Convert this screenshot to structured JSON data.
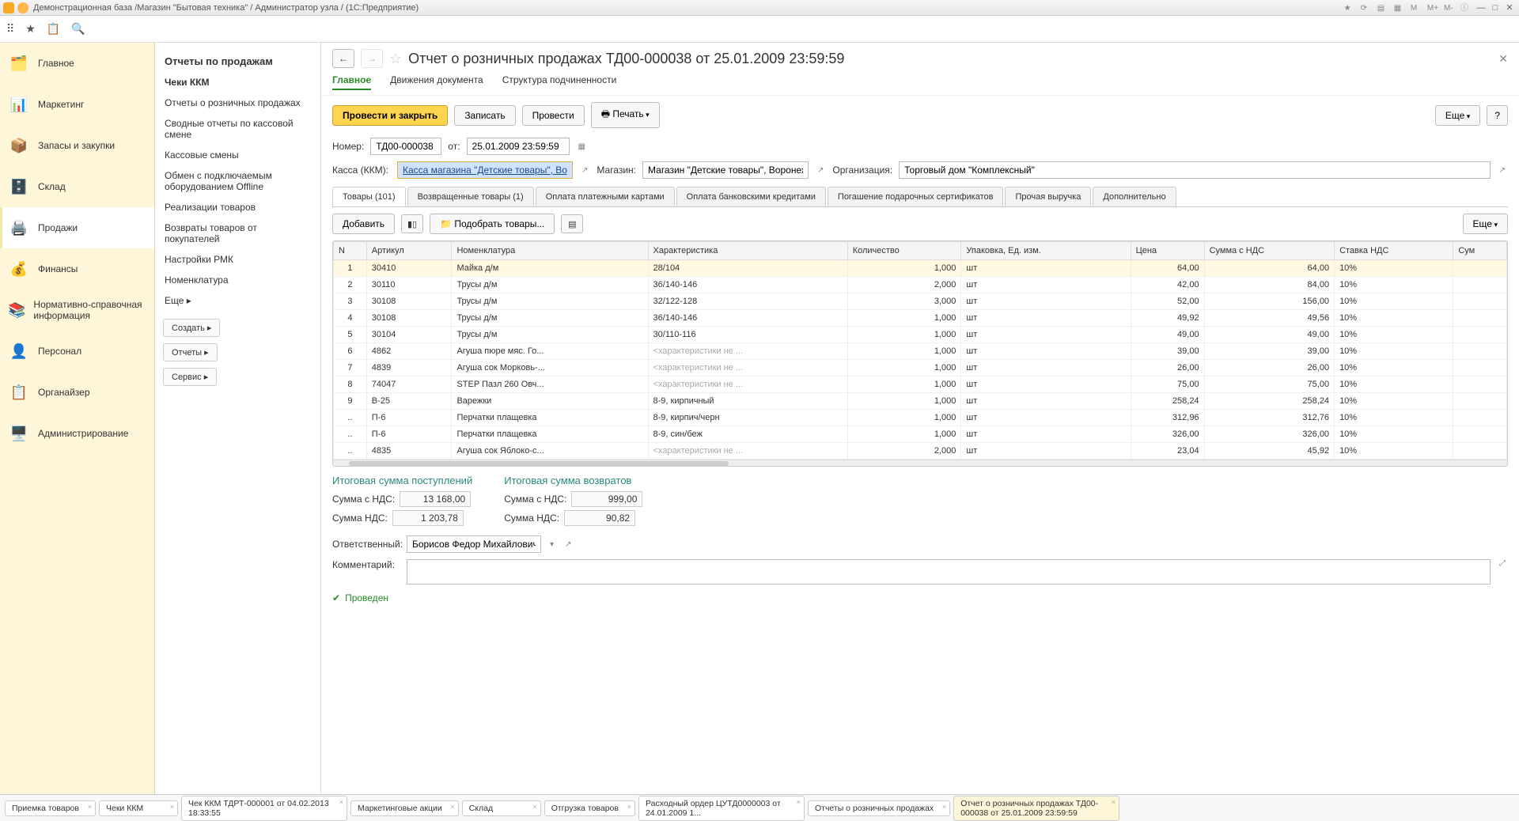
{
  "titlebar": {
    "title": "Демонстрационная база /Магазин \"Бытовая техника\" / Администратор узла / (1С:Предприятие)"
  },
  "sidebar1": [
    {
      "icon": "🗂️",
      "label": "Главное"
    },
    {
      "icon": "📊",
      "label": "Маркетинг"
    },
    {
      "icon": "📦",
      "label": "Запасы и закупки"
    },
    {
      "icon": "🗄️",
      "label": "Склад"
    },
    {
      "icon": "🖨️",
      "label": "Продажи",
      "active": true
    },
    {
      "icon": "💰",
      "label": "Финансы"
    },
    {
      "icon": "📚",
      "label": "Нормативно-справочная информация"
    },
    {
      "icon": "👤",
      "label": "Персонал"
    },
    {
      "icon": "📋",
      "label": "Органайзер"
    },
    {
      "icon": "🖥️",
      "label": "Администрирование"
    }
  ],
  "sidebar2": {
    "title": "Отчеты по продажам",
    "items": [
      {
        "label": "Чеки ККМ",
        "bold": true
      },
      {
        "label": "Отчеты о розничных продажах"
      },
      {
        "label": "Сводные отчеты по кассовой смене"
      },
      {
        "label": "Кассовые смены"
      },
      {
        "label": "Обмен с подключаемым оборудованием Offline"
      },
      {
        "label": "Реализации товаров"
      },
      {
        "label": "Возвраты товаров от покупателей"
      },
      {
        "label": "Настройки РМК"
      },
      {
        "label": "Номенклатура"
      },
      {
        "label": "Еще ▸"
      }
    ],
    "buttons": [
      "Создать ▸",
      "Отчеты ▸",
      "Сервис ▸"
    ]
  },
  "doc": {
    "title": "Отчет о розничных продажах ТД00-000038 от 25.01.2009 23:59:59",
    "subnav": [
      "Главное",
      "Движения документа",
      "Структура подчиненности"
    ],
    "actions": {
      "primary": "Провести и закрыть",
      "save": "Записать",
      "post": "Провести",
      "print": "Печать",
      "more": "Еще",
      "help": "?"
    },
    "fields": {
      "number_label": "Номер:",
      "number": "ТД00-000038",
      "date_label": "от:",
      "date": "25.01.2009 23:59:59",
      "kassa_label": "Касса (ККМ):",
      "kassa": "Касса магазина \"Детские товары\", Воронеж",
      "store_label": "Магазин:",
      "store": "Магазин \"Детские товары\", Воронеж",
      "org_label": "Организация:",
      "org": "Торговый дом \"Комплексный\""
    },
    "tabs": [
      "Товары (101)",
      "Возвращенные товары (1)",
      "Оплата платежными картами",
      "Оплата банковскими кредитами",
      "Погашение подарочных сертификатов",
      "Прочая выручка",
      "Дополнительно"
    ],
    "tabtools": {
      "add": "Добавить",
      "pick": "Подобрать товары...",
      "more": "Еще"
    },
    "gridhead": [
      "N",
      "Артикул",
      "Номенклатура",
      "Характеристика",
      "Количество",
      "Упаковка, Ед. изм.",
      "Цена",
      "Сумма с НДС",
      "Ставка НДС",
      "Сум"
    ],
    "rows": [
      {
        "n": "1",
        "art": "30410",
        "nom": "Майка д/м",
        "char": "28/104",
        "qty": "1,000",
        "unit": "шт",
        "price": "64,00",
        "sum": "64,00",
        "vat": "10%",
        "sel": true
      },
      {
        "n": "2",
        "art": "30110",
        "nom": "Трусы д/м",
        "char": "36/140-146",
        "qty": "2,000",
        "unit": "шт",
        "price": "42,00",
        "sum": "84,00",
        "vat": "10%"
      },
      {
        "n": "3",
        "art": "30108",
        "nom": "Трусы д/м",
        "char": "32/122-128",
        "qty": "3,000",
        "unit": "шт",
        "price": "52,00",
        "sum": "156,00",
        "vat": "10%"
      },
      {
        "n": "4",
        "art": "30108",
        "nom": "Трусы д/м",
        "char": "36/140-146",
        "qty": "1,000",
        "unit": "шт",
        "price": "49,92",
        "sum": "49,56",
        "vat": "10%"
      },
      {
        "n": "5",
        "art": "30104",
        "nom": "Трусы д/м",
        "char": "30/110-116",
        "qty": "1,000",
        "unit": "шт",
        "price": "49,00",
        "sum": "49,00",
        "vat": "10%"
      },
      {
        "n": "6",
        "art": "4862",
        "nom": "Агуша пюре мяс. Го...",
        "char": "<характеристики не ...",
        "qty": "1,000",
        "unit": "шт",
        "price": "39,00",
        "sum": "39,00",
        "vat": "10%",
        "muted": true
      },
      {
        "n": "7",
        "art": "4839",
        "nom": "Агуша сок Морковь-...",
        "char": "<характеристики не ...",
        "qty": "1,000",
        "unit": "шт",
        "price": "26,00",
        "sum": "26,00",
        "vat": "10%",
        "muted": true
      },
      {
        "n": "8",
        "art": "74047",
        "nom": "STEP Пазл 260 Овч...",
        "char": "<характеристики не ...",
        "qty": "1,000",
        "unit": "шт",
        "price": "75,00",
        "sum": "75,00",
        "vat": "10%",
        "muted": true
      },
      {
        "n": "9",
        "art": "В-25",
        "nom": "Варежки",
        "char": "8-9, кирпичный",
        "qty": "1,000",
        "unit": "шт",
        "price": "258,24",
        "sum": "258,24",
        "vat": "10%"
      },
      {
        "n": "..",
        "art": "П-6",
        "nom": "Перчатки плащевка",
        "char": "8-9, кирпич/черн",
        "qty": "1,000",
        "unit": "шт",
        "price": "312,96",
        "sum": "312,76",
        "vat": "10%"
      },
      {
        "n": "..",
        "art": "П-6",
        "nom": "Перчатки плащевка",
        "char": "8-9, син/беж",
        "qty": "1,000",
        "unit": "шт",
        "price": "326,00",
        "sum": "326,00",
        "vat": "10%"
      },
      {
        "n": "..",
        "art": "4835",
        "nom": "Агуша сок Яблоко-с...",
        "char": "<характеристики не ...",
        "qty": "2,000",
        "unit": "шт",
        "price": "23,04",
        "sum": "45,92",
        "vat": "10%",
        "muted": true
      }
    ],
    "totals": {
      "in_title": "Итоговая сумма поступлений",
      "ret_title": "Итоговая сумма возвратов",
      "sum_label": "Сумма с НДС:",
      "vat_label": "Сумма НДС:",
      "in_sum": "13 168,00",
      "in_vat": "1 203,78",
      "ret_sum": "999,00",
      "ret_vat": "90,82"
    },
    "resp_label": "Ответственный:",
    "resp": "Борисов Федор Михайлович",
    "comment_label": "Комментарий:",
    "status": "Проведен"
  },
  "bottom_tabs": [
    {
      "label": "Приемка товаров"
    },
    {
      "label": "Чеки ККМ"
    },
    {
      "label": "Чек ККМ ТДРТ-000001 от 04.02.2013 18:33:55"
    },
    {
      "label": "Маркетинговые акции"
    },
    {
      "label": "Склад"
    },
    {
      "label": "Отгрузка товаров"
    },
    {
      "label": "Расходный ордер ЦУТД0000003 от 24.01.2009 1..."
    },
    {
      "label": "Отчеты о розничных продажах"
    },
    {
      "label": "Отчет о розничных продажах ТД00-000038 от 25.01.2009 23:59:59",
      "active": true
    }
  ]
}
